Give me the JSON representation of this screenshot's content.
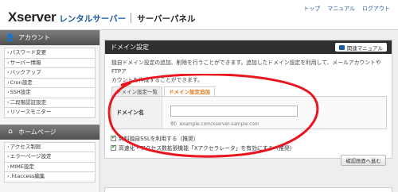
{
  "header": {
    "brand": "Xserver",
    "sub": "レンタルサーバー",
    "panel": "サーバーパネル",
    "links": [
      "トップ",
      "マニュアル",
      "ログアウト"
    ]
  },
  "sidebar": {
    "sections": [
      {
        "title": "アカウント",
        "icon": "user-icon",
        "items": [
          "パスワード変更",
          "サーバー情報",
          "バックアップ",
          "Cron設定",
          "SSH設定",
          "二段階認証設定",
          "リソースモニター"
        ]
      },
      {
        "title": "ホームページ",
        "icon": "home-icon",
        "items": [
          "アクセス制限",
          "エラーページ設定",
          "MIME設定",
          ".htaccess編集"
        ]
      }
    ]
  },
  "main": {
    "title": "ドメイン設定",
    "help_button": "関連マニュアル",
    "description_line1": "独自ドメイン設定の追加、削除を行うことができます。追加したドメイン設定を利用して、メールアカウントやFTPア",
    "description_line2": "カウントを作成することができます。",
    "tabs": [
      "ドメイン設定一覧",
      "ドメイン設定追加"
    ],
    "active_tab": "ドメイン設定追加",
    "form": {
      "label": "ドメイン名",
      "value": "",
      "placeholder": "",
      "example": "例）example.com/xserver-sample.com"
    },
    "options": [
      {
        "label": "無料独自SSLを利用する（推奨）",
        "checked": true
      },
      {
        "label": "高速化・アクセス数拡張機能「Xアクセラレータ」を有効にする（推奨）",
        "checked": true
      }
    ],
    "confirm_button": "確認画面へ進む"
  },
  "colors": {
    "panel_header": "#2f2f2f",
    "link": "#2a5aa6",
    "brand_blue": "#1a5a9e",
    "active_tab": "#e07a1a",
    "annotation": "#e8161e"
  }
}
